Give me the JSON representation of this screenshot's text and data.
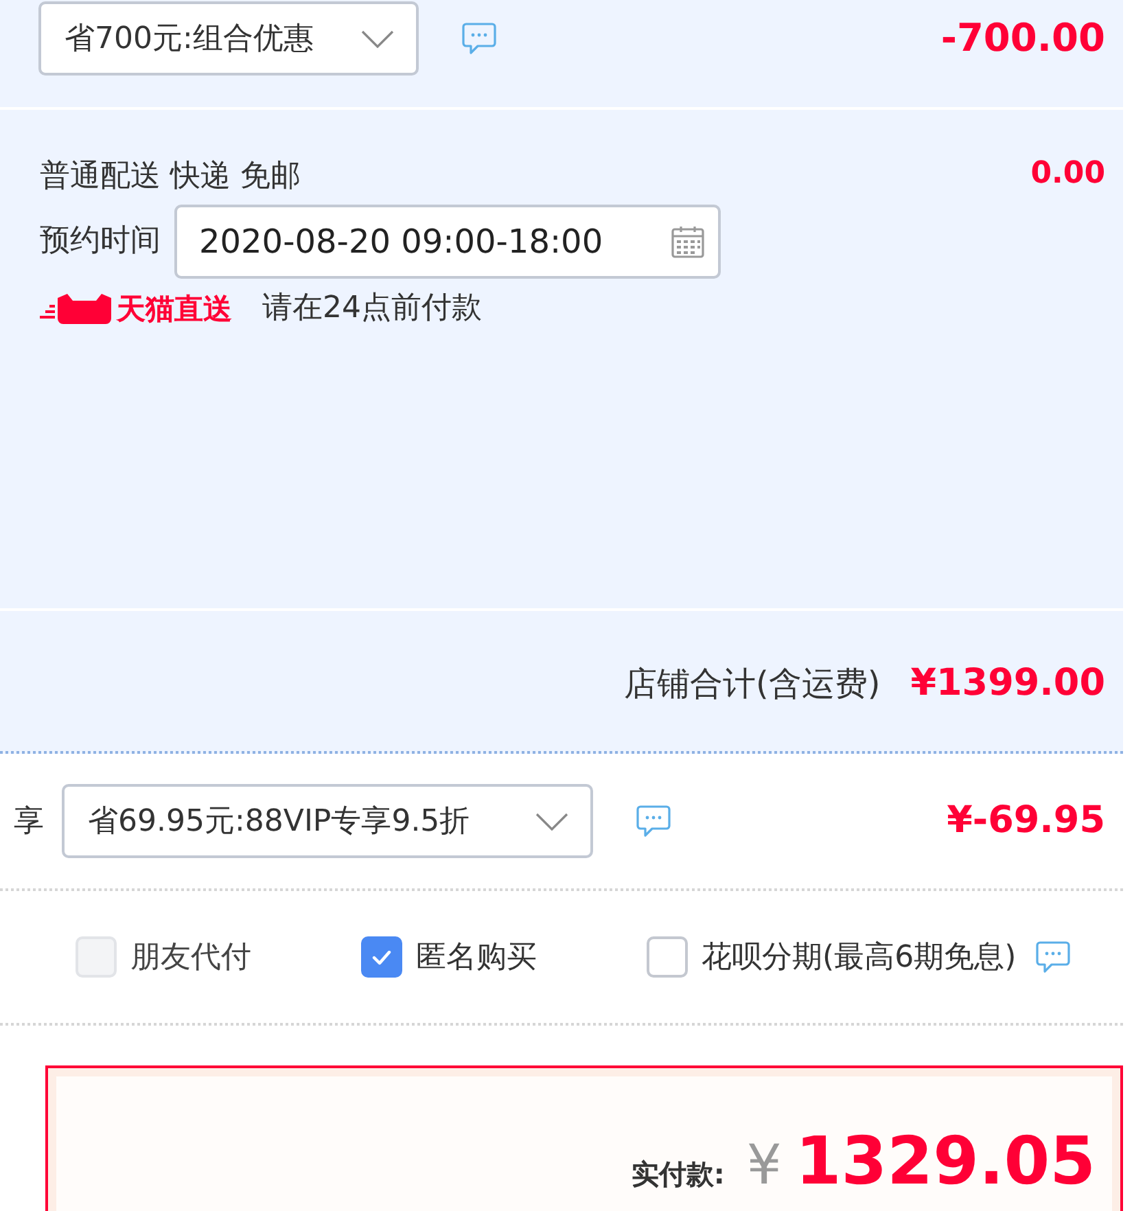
{
  "promotion": {
    "dropdown": "省700元:组合优惠",
    "amount": "-700.00"
  },
  "delivery": {
    "method": "普通配送 快递 免邮",
    "fee": "0.00",
    "schedule_label": "预约时间",
    "schedule_value": "2020-08-20 09:00-18:00",
    "badge": "天猫直送",
    "note": "请在24点前付款"
  },
  "store_total": {
    "label": "店铺合计(含运费)",
    "amount": "¥1399.00"
  },
  "vip_discount": {
    "label": "享",
    "dropdown": "省69.95元:88VIP专享9.5折",
    "amount": "¥-69.95"
  },
  "options": [
    {
      "label": "朋友代付",
      "checked": false,
      "disabled": true,
      "info_icon": false
    },
    {
      "label": "匿名购买",
      "checked": true,
      "disabled": false,
      "info_icon": false
    },
    {
      "label": "花呗分期(最高6期免息)",
      "checked": false,
      "disabled": false,
      "info_icon": true
    }
  ],
  "payment": {
    "label": "实付款:",
    "currency": "¥",
    "amount": "1329.05"
  }
}
